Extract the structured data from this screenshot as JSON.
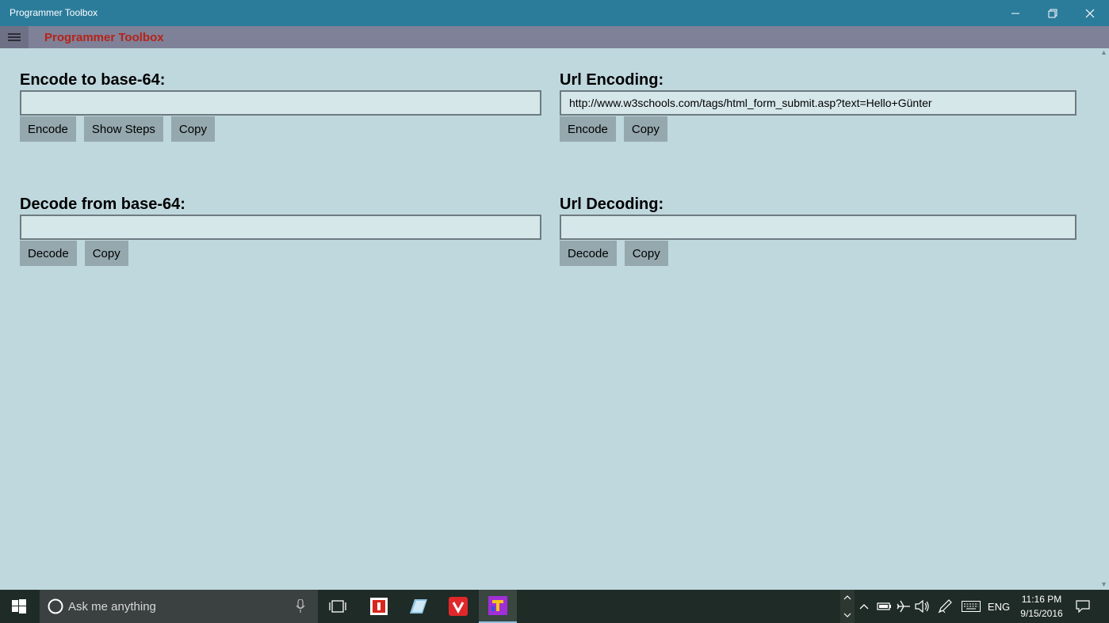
{
  "window": {
    "title": "Programmer Toolbox"
  },
  "appbar": {
    "title": "Programmer Toolbox"
  },
  "encode_base64": {
    "heading": "Encode to base-64:",
    "value": "",
    "buttons": {
      "encode": "Encode",
      "show_steps": "Show Steps",
      "copy": "Copy"
    }
  },
  "decode_base64": {
    "heading": "Decode from base-64:",
    "value": "",
    "buttons": {
      "decode": "Decode",
      "copy": "Copy"
    }
  },
  "url_encoding": {
    "heading": "Url Encoding:",
    "value": "http://www.w3schools.com/tags/html_form_submit.asp?text=Hello+Günter",
    "buttons": {
      "encode": "Encode",
      "copy": "Copy"
    }
  },
  "url_decoding": {
    "heading": "Url Decoding:",
    "value": "",
    "buttons": {
      "decode": "Decode",
      "copy": "Copy"
    }
  },
  "taskbar": {
    "search_placeholder": "Ask me anything",
    "language": "ENG",
    "time": "11:16 PM",
    "date": "9/15/2016"
  },
  "colors": {
    "titlebar": "#2b7c9b",
    "appbar": "#7e8198",
    "apptitle": "#b72318",
    "background": "#bfd8de",
    "button": "#94a8ae"
  }
}
